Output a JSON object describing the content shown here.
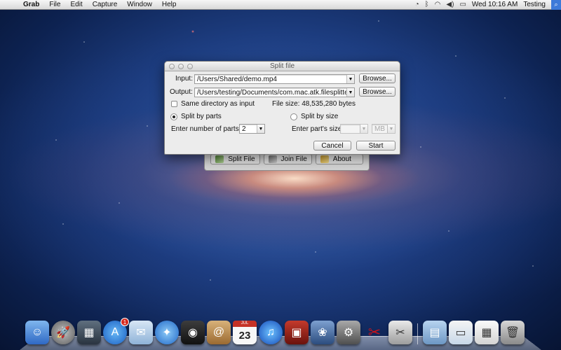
{
  "menubar": {
    "app_name": "Grab",
    "menus": [
      "File",
      "Edit",
      "Capture",
      "Window",
      "Help"
    ],
    "clock": "Wed 10:16 AM",
    "user": "Testing"
  },
  "dialog": {
    "title": "Split file",
    "input_label": "Input:",
    "input_value": "/Users/Shared/demo.mp4",
    "browse_label": "Browse...",
    "output_label": "Output:",
    "output_value": "/Users/testing/Documents/com.mac.atk.filesplitter",
    "same_dir_label": "Same directory as input",
    "file_size_text": "File size: 48,535,280 bytes",
    "split_by_parts_label": "Split by parts",
    "split_by_size_label": "Split by size",
    "num_parts_label": "Enter number of parts:",
    "num_parts_value": "2",
    "part_size_label": "Enter part's size:",
    "part_size_value": "",
    "unit_value": "MB",
    "cancel_label": "Cancel",
    "start_label": "Start"
  },
  "main_window": {
    "split_label": "Split File",
    "join_label": "Join File",
    "about_label": "About"
  },
  "dock": {
    "app_store_badge": "1",
    "calendar_month": "JUL",
    "calendar_day": "23"
  },
  "colors": {
    "menubar": "#e6e6e6",
    "dialog_bg": "#ececec",
    "badge": "#d8291e"
  }
}
